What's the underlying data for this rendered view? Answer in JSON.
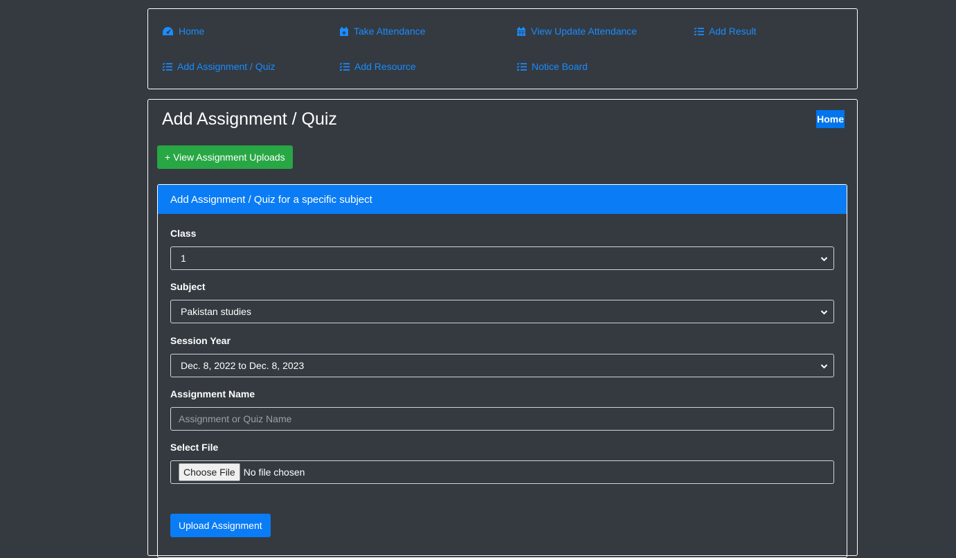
{
  "nav": {
    "items": [
      {
        "label": "Home",
        "icon": "dashboard-icon"
      },
      {
        "label": "Take Attendance",
        "icon": "calendar-plus-icon"
      },
      {
        "label": "View Update Attendance",
        "icon": "calendar-icon"
      },
      {
        "label": "Add Result",
        "icon": "list-check-icon"
      },
      {
        "label": "Add Assignment / Quiz",
        "icon": "list-check-icon"
      },
      {
        "label": "Add Resource",
        "icon": "list-check-icon"
      },
      {
        "label": "Notice Board",
        "icon": "list-check-icon"
      }
    ],
    "link_color": "#1a8cff"
  },
  "main": {
    "title": "Add Assignment / Quiz",
    "home_badge": "Home",
    "view_uploads_button": "+ View Assignment Uploads"
  },
  "card": {
    "header": "Add Assignment / Quiz for a specific subject",
    "class": {
      "label": "Class",
      "value": "1"
    },
    "subject": {
      "label": "Subject",
      "value": "Pakistan studies"
    },
    "session_year": {
      "label": "Session Year",
      "value": "Dec. 8, 2022 to Dec. 8, 2023"
    },
    "assignment_name": {
      "label": "Assignment Name",
      "placeholder": "Assignment or Quiz Name",
      "value": ""
    },
    "file": {
      "label": "Select File",
      "button": "Choose File",
      "status": "No file chosen"
    },
    "submit": "Upload Assignment"
  },
  "colors": {
    "background": "#343a40",
    "primary": "#0a7cf5",
    "success": "#28a745"
  }
}
